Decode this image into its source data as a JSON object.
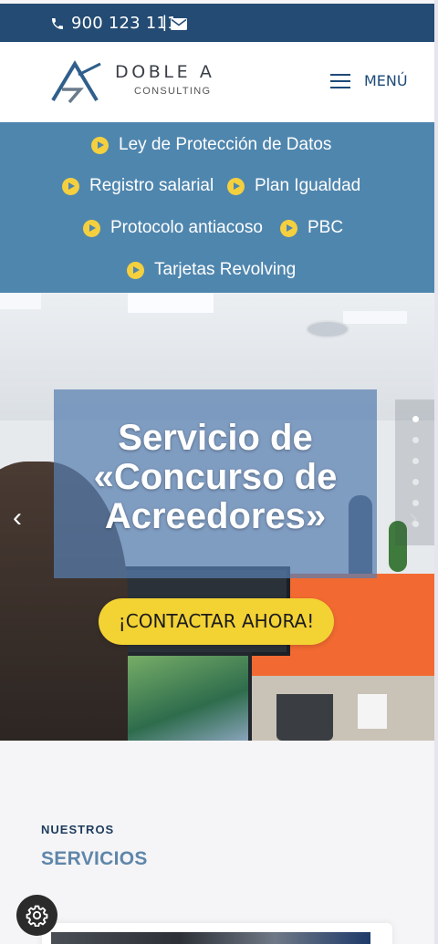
{
  "topbar": {
    "phone": "900 123 111",
    "separator": "|",
    "phone_icon": "phone-icon",
    "mail_icon": "envelope-icon"
  },
  "header": {
    "brand": "DOBLE A",
    "brand_sub": "CONSULTING",
    "menu_label": "MENÚ"
  },
  "links": [
    {
      "label": "Ley de Protección de Datos"
    },
    {
      "label": "Registro salarial"
    },
    {
      "label": "Plan Igualdad"
    },
    {
      "label": "Protocolo antiacoso"
    },
    {
      "label": "PBC"
    },
    {
      "label": "Tarjetas Revolving"
    }
  ],
  "hero": {
    "title_line1": "Servicio de",
    "title_line2": "«Concurso de",
    "title_line3": "Acreedores»",
    "cta_label": "¡CONTACTAR AHORA!",
    "prev_arrow": "‹",
    "next_arrow": "›",
    "slide_count": 6,
    "active_slide": 1
  },
  "services": {
    "kicker": "NUESTROS",
    "title": "SERVICIOS"
  },
  "colors": {
    "topbar": "#234b74",
    "links_bg": "#4f86ae",
    "accent_yellow": "#f3d234",
    "title_blue": "#5f86aa"
  }
}
